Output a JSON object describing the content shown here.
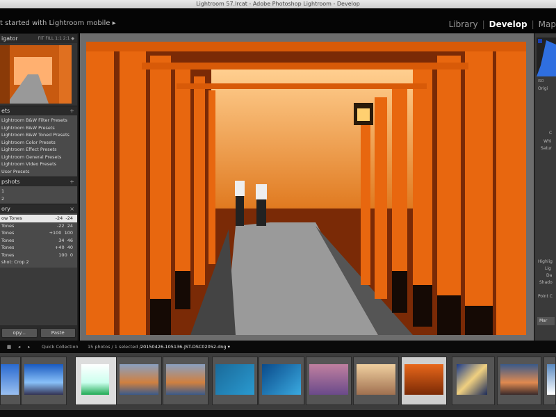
{
  "window": {
    "title": "Lightroom 57.lrcat - Adobe Photoshop Lightroom - Develop"
  },
  "top": {
    "mobile": "t started with Lightroom mobile ▸",
    "modules": [
      "Library",
      "Develop",
      "Map"
    ],
    "active": "Develop"
  },
  "left": {
    "navigator": {
      "title": "igator",
      "zoom": "FIT  FILL  1:1  2:1 ◆"
    },
    "presets": {
      "title": "ets",
      "items": [
        "Lightroom B&W Filter Presets",
        "Lightroom B&W Presets",
        "Lightroom B&W Toned Presets",
        "Lightroom Color Presets",
        "Lightroom Effect Presets",
        "Lightroom General Presets",
        "Lightroom Video Presets",
        "User Presets"
      ]
    },
    "snapshots": {
      "title": "pshots",
      "items": [
        "1",
        "2"
      ]
    },
    "history": {
      "title": "ory",
      "items": [
        {
          "label": "ow Tones",
          "a": "-24",
          "b": "-24"
        },
        {
          "label": "Tones",
          "a": "-22",
          "b": "24"
        },
        {
          "label": "Tones",
          "a": "+100",
          "b": "100"
        },
        {
          "label": "Tones",
          "a": "34",
          "b": "46"
        },
        {
          "label": "Tones",
          "a": "+40",
          "b": "40"
        },
        {
          "label": "Tones",
          "a": "100",
          "b": "0"
        },
        {
          "label": "shot: Crop 2",
          "a": "",
          "b": ""
        }
      ]
    },
    "copy": "opy...",
    "paste": "Paste"
  },
  "right": {
    "items": [
      "ISO",
      "Origi",
      "C",
      "Whi",
      "Satur",
      "Highlig",
      "Lig",
      "Da",
      "Shado",
      "Point C",
      "Mar"
    ]
  },
  "toolbar": {
    "collection": "Quick Collection",
    "info": "15 photos / 1 selected /",
    "filename": "20150426-105136-JST-DSC02052.dng ▾"
  },
  "colors": {
    "accent": "#e8671a",
    "panel": "#3a3a3a"
  }
}
